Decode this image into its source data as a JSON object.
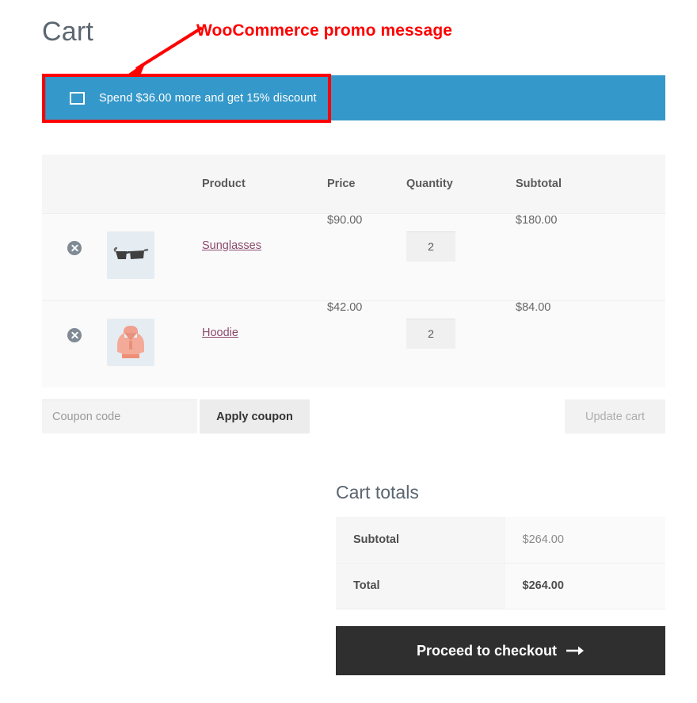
{
  "page": {
    "title": "Cart"
  },
  "annotation": {
    "label": "WooCommerce promo message",
    "color": "#ff0000",
    "arrow_icon": "arrow-down-left-icon"
  },
  "promo": {
    "message": "Spend $36.00 more and get 15% discount",
    "icon": "square-outline-icon",
    "background": "#3498ca",
    "edge_color": "#3089b7",
    "text_color": "#ffffff"
  },
  "cart_table": {
    "headers": [
      "",
      "",
      "Product",
      "Price",
      "Quantity",
      "Subtotal"
    ],
    "rows": [
      {
        "remove_icon": "remove-circle-x-icon",
        "thumbnail": "sunglasses-thumbnail",
        "product": "Sunglasses",
        "price": "$90.00",
        "quantity": "2",
        "subtotal": "$180.00"
      },
      {
        "remove_icon": "remove-circle-x-icon",
        "thumbnail": "hoodie-thumbnail",
        "product": "Hoodie",
        "price": "$42.00",
        "quantity": "2",
        "subtotal": "$84.00"
      }
    ]
  },
  "coupon": {
    "placeholder": "Coupon code",
    "value": "",
    "apply_label": "Apply coupon",
    "update_label": "Update cart"
  },
  "totals": {
    "title": "Cart totals",
    "rows": [
      {
        "label": "Subtotal",
        "value": "$264.00"
      },
      {
        "label": "Total",
        "value": "$264.00"
      }
    ],
    "checkout_label": "Proceed to checkout",
    "checkout_arrow": "arrow-right-icon",
    "checkout_bg": "#2f2f2f"
  }
}
